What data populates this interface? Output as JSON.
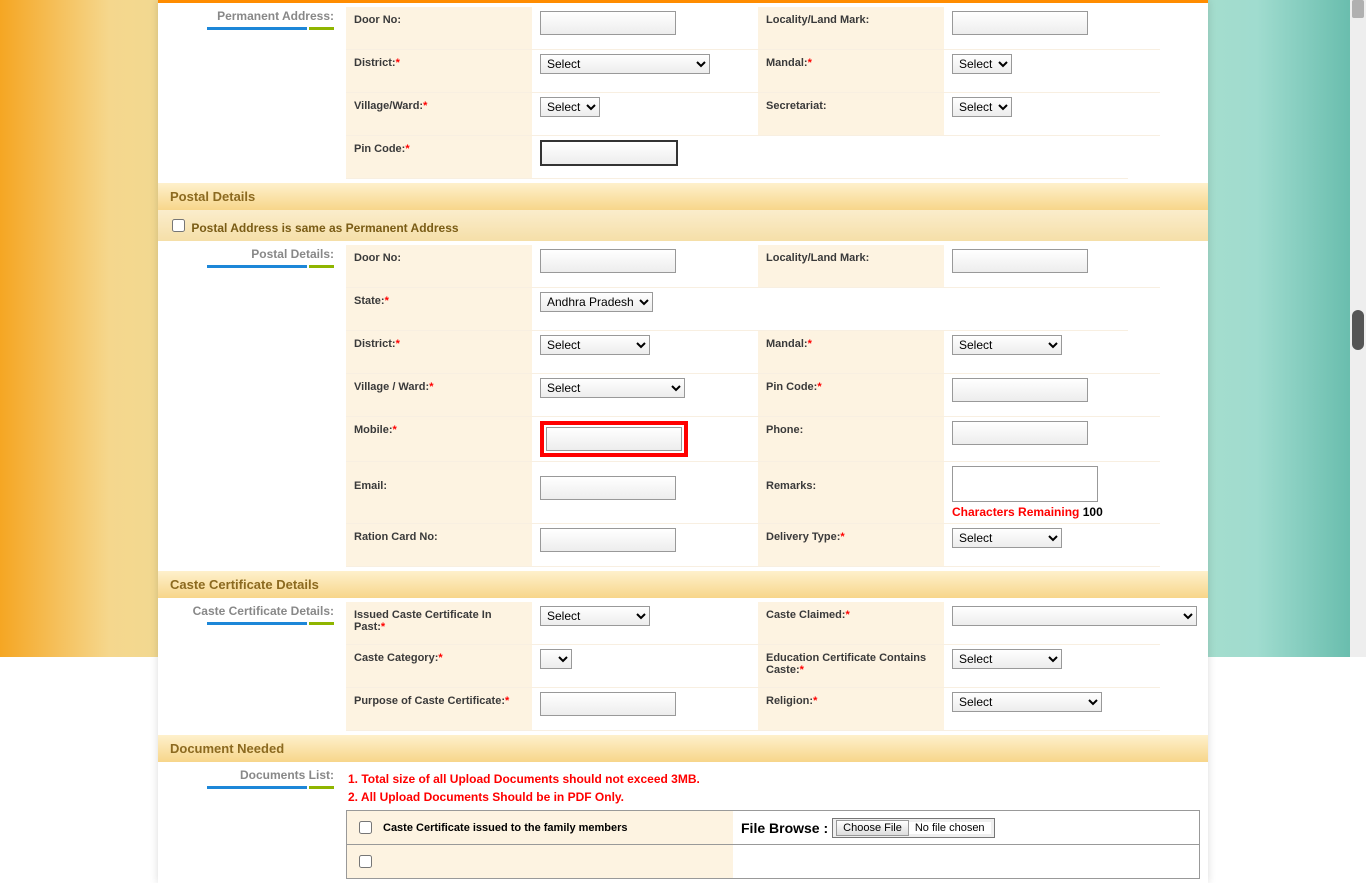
{
  "sections": {
    "permanent_address": {
      "side_label": "Permanent Address:",
      "door_no_label": "Door No:",
      "locality_label": "Locality/Land Mark:",
      "district_label": "District:",
      "mandal_label": "Mandal:",
      "village_label": "Village/Ward:",
      "secretariat_label": "Secretariat:",
      "pincode_label": "Pin Code:",
      "select_opt": "Select"
    },
    "postal": {
      "header": "Postal Details",
      "same_as_label": "Postal Address is same as Permanent Address",
      "side_label": "Postal Details:",
      "door_no_label": "Door No:",
      "locality_label": "Locality/Land Mark:",
      "state_label": "State:",
      "state_opt": "Andhra Pradesh",
      "district_label": "District:",
      "mandal_label": "Mandal:",
      "village_label": "Village / Ward:",
      "pincode_label": "Pin Code:",
      "mobile_label": "Mobile:",
      "phone_label": "Phone:",
      "email_label": "Email:",
      "remarks_label": "Remarks:",
      "chars_remaining_label": "Characters Remaining",
      "chars_remaining_count": "100",
      "ration_label": "Ration Card No:",
      "delivery_label": "Delivery Type:",
      "select_opt": "Select"
    },
    "caste": {
      "header": "Caste Certificate Details",
      "side_label": "Caste Certificate Details:",
      "issued_past_label": "Issued Caste Certificate In Past:",
      "caste_claimed_label": "Caste Claimed:",
      "caste_category_label": "Caste Category:",
      "edu_cert_label": "Education Certificate Contains Caste:",
      "purpose_label": "Purpose of Caste Certificate:",
      "religion_label": "Religion:",
      "select_opt": "Select"
    },
    "documents": {
      "header": "Document Needed",
      "side_label": "Documents List:",
      "instr1": "1. Total size of all Upload Documents should not exceed 3MB.",
      "instr2": "2. All Upload Documents Should be in PDF Only.",
      "doc1_label": "Caste Certificate issued to the family members",
      "file_browse_label": "File Browse :",
      "choose_file_btn": "Choose File",
      "no_file_text": "No file chosen"
    }
  }
}
